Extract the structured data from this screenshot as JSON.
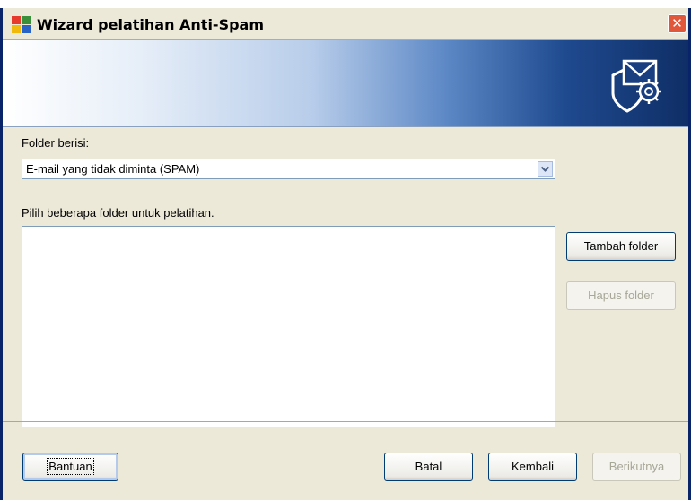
{
  "window": {
    "title": "Wizard pelatihan Anti-Spam",
    "close_glyph": "✕",
    "accent": "#0a246a"
  },
  "banner": {
    "icon": "shield-mail-gear-icon"
  },
  "folder_contains": {
    "label": "Folder berisi:",
    "selected": "E-mail yang tidak diminta (SPAM)"
  },
  "folder_list": {
    "label": "Pilih beberapa folder untuk pelatihan."
  },
  "buttons": {
    "add_folder": "Tambah folder",
    "remove_folder": "Hapus folder",
    "help": "Bantuan",
    "cancel": "Batal",
    "back": "Kembali",
    "next": "Berikutnya"
  }
}
